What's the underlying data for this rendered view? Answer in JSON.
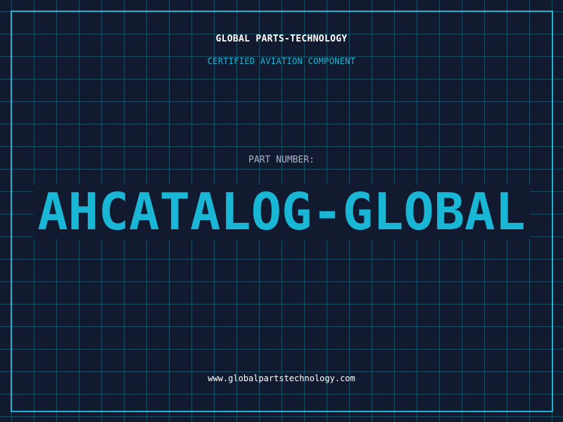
{
  "header": {
    "company": "GLOBAL PARTS-TECHNOLOGY",
    "subtitle": "CERTIFIED AVIATION COMPONENT"
  },
  "part": {
    "label": "PART NUMBER:",
    "number": "AHCATALOG-GLOBAL"
  },
  "footer": {
    "website": "www.globalpartstechnology.com"
  },
  "colors": {
    "background": "#111a2e",
    "accent": "#1ab6d6",
    "grid": "#1f788c",
    "label": "#a9b4c4",
    "text": "#ffffff"
  }
}
